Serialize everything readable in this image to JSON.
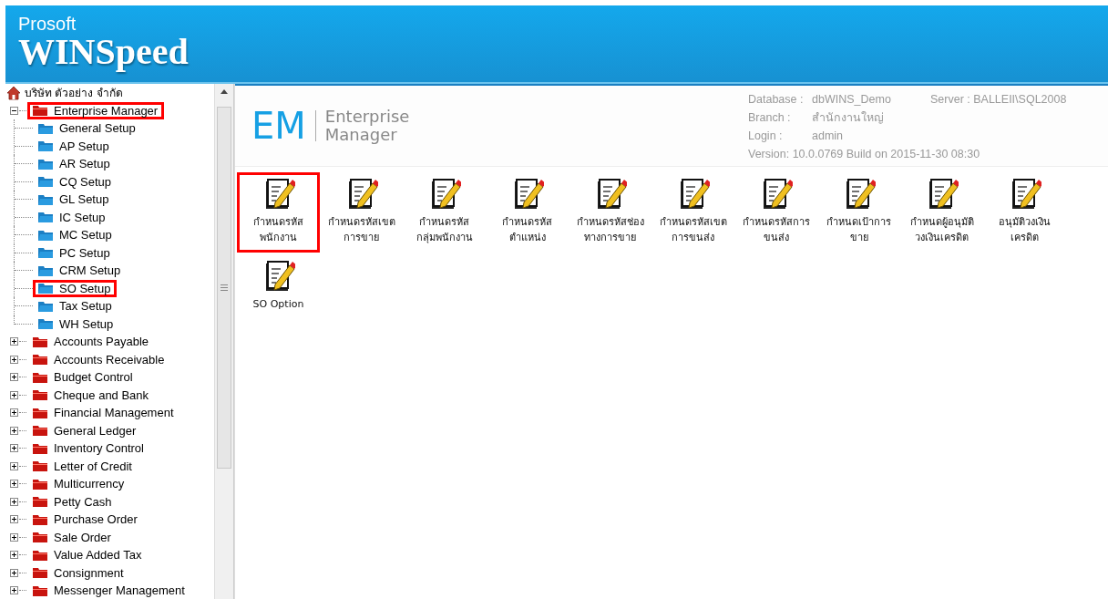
{
  "header": {
    "brand_small": "Prosoft",
    "brand_large": "WINSpeed"
  },
  "tree": {
    "root": "บริษัท ตัวอย่าง จำกัด",
    "items": [
      {
        "label": "Enterprise Manager",
        "expanded": true,
        "highlighted": true,
        "children": [
          {
            "label": "General Setup",
            "highlighted": false
          },
          {
            "label": "AP Setup",
            "highlighted": false
          },
          {
            "label": "AR Setup",
            "highlighted": false
          },
          {
            "label": "CQ Setup",
            "highlighted": false
          },
          {
            "label": "GL Setup",
            "highlighted": false
          },
          {
            "label": "IC Setup",
            "highlighted": false
          },
          {
            "label": "MC Setup",
            "highlighted": false
          },
          {
            "label": "PC Setup",
            "highlighted": false
          },
          {
            "label": "CRM Setup",
            "highlighted": false
          },
          {
            "label": "SO Setup",
            "highlighted": true
          },
          {
            "label": "Tax Setup",
            "highlighted": false
          },
          {
            "label": "WH Setup",
            "highlighted": false
          }
        ]
      },
      {
        "label": "Accounts Payable",
        "expanded": false,
        "highlighted": false
      },
      {
        "label": "Accounts Receivable",
        "expanded": false,
        "highlighted": false
      },
      {
        "label": "Budget Control",
        "expanded": false,
        "highlighted": false
      },
      {
        "label": "Cheque and Bank",
        "expanded": false,
        "highlighted": false
      },
      {
        "label": "Financial Management",
        "expanded": false,
        "highlighted": false
      },
      {
        "label": "General Ledger",
        "expanded": false,
        "highlighted": false
      },
      {
        "label": "Inventory Control",
        "expanded": false,
        "highlighted": false
      },
      {
        "label": "Letter of Credit",
        "expanded": false,
        "highlighted": false
      },
      {
        "label": "Multicurrency",
        "expanded": false,
        "highlighted": false
      },
      {
        "label": "Petty Cash",
        "expanded": false,
        "highlighted": false
      },
      {
        "label": "Purchase Order",
        "expanded": false,
        "highlighted": false
      },
      {
        "label": "Sale Order",
        "expanded": false,
        "highlighted": false
      },
      {
        "label": "Value Added Tax",
        "expanded": false,
        "highlighted": false
      },
      {
        "label": "Consignment",
        "expanded": false,
        "highlighted": false
      },
      {
        "label": "Messenger Management",
        "expanded": false,
        "highlighted": false
      }
    ]
  },
  "module_header": {
    "logo": "EM",
    "title": [
      "Enterprise",
      "Manager"
    ],
    "info": [
      {
        "label": "Database :",
        "value": "dbWINS_Demo"
      },
      {
        "label": "Branch :",
        "value": "สำนักงานใหญ่"
      },
      {
        "label": "Login :",
        "value": "admin"
      }
    ],
    "server": "Server : BALLEII\\SQL2008",
    "version": "Version: 10.0.0769  Build on 2015-11-30 08:30"
  },
  "tiles": [
    {
      "lines": [
        "กำหนดรหัส",
        "พนักงาน"
      ],
      "highlighted": true
    },
    {
      "lines": [
        "กำหนดรหัสเขต",
        "การขาย"
      ],
      "highlighted": false
    },
    {
      "lines": [
        "กำหนดรหัส",
        "กลุ่มพนักงาน"
      ],
      "highlighted": false
    },
    {
      "lines": [
        "กำหนดรหัส",
        "ตำแหน่ง"
      ],
      "highlighted": false
    },
    {
      "lines": [
        "กำหนดรหัสช่อง",
        "ทางการขาย"
      ],
      "highlighted": false
    },
    {
      "lines": [
        "กำหนดรหัสเขต",
        "การขนส่ง"
      ],
      "highlighted": false
    },
    {
      "lines": [
        "กำหนดรหัสการ",
        "ขนส่ง"
      ],
      "highlighted": false
    },
    {
      "lines": [
        "กำหนดเป้าการ",
        "ขาย"
      ],
      "highlighted": false
    },
    {
      "lines": [
        "กำหนดผู้อนุมัติ",
        "วงเงินเครดิต"
      ],
      "highlighted": false
    },
    {
      "lines": [
        "อนุมัติวงเงิน",
        "เครดิต"
      ],
      "highlighted": false
    },
    {
      "lines": [
        "SO Option"
      ],
      "highlighted": false
    }
  ]
}
